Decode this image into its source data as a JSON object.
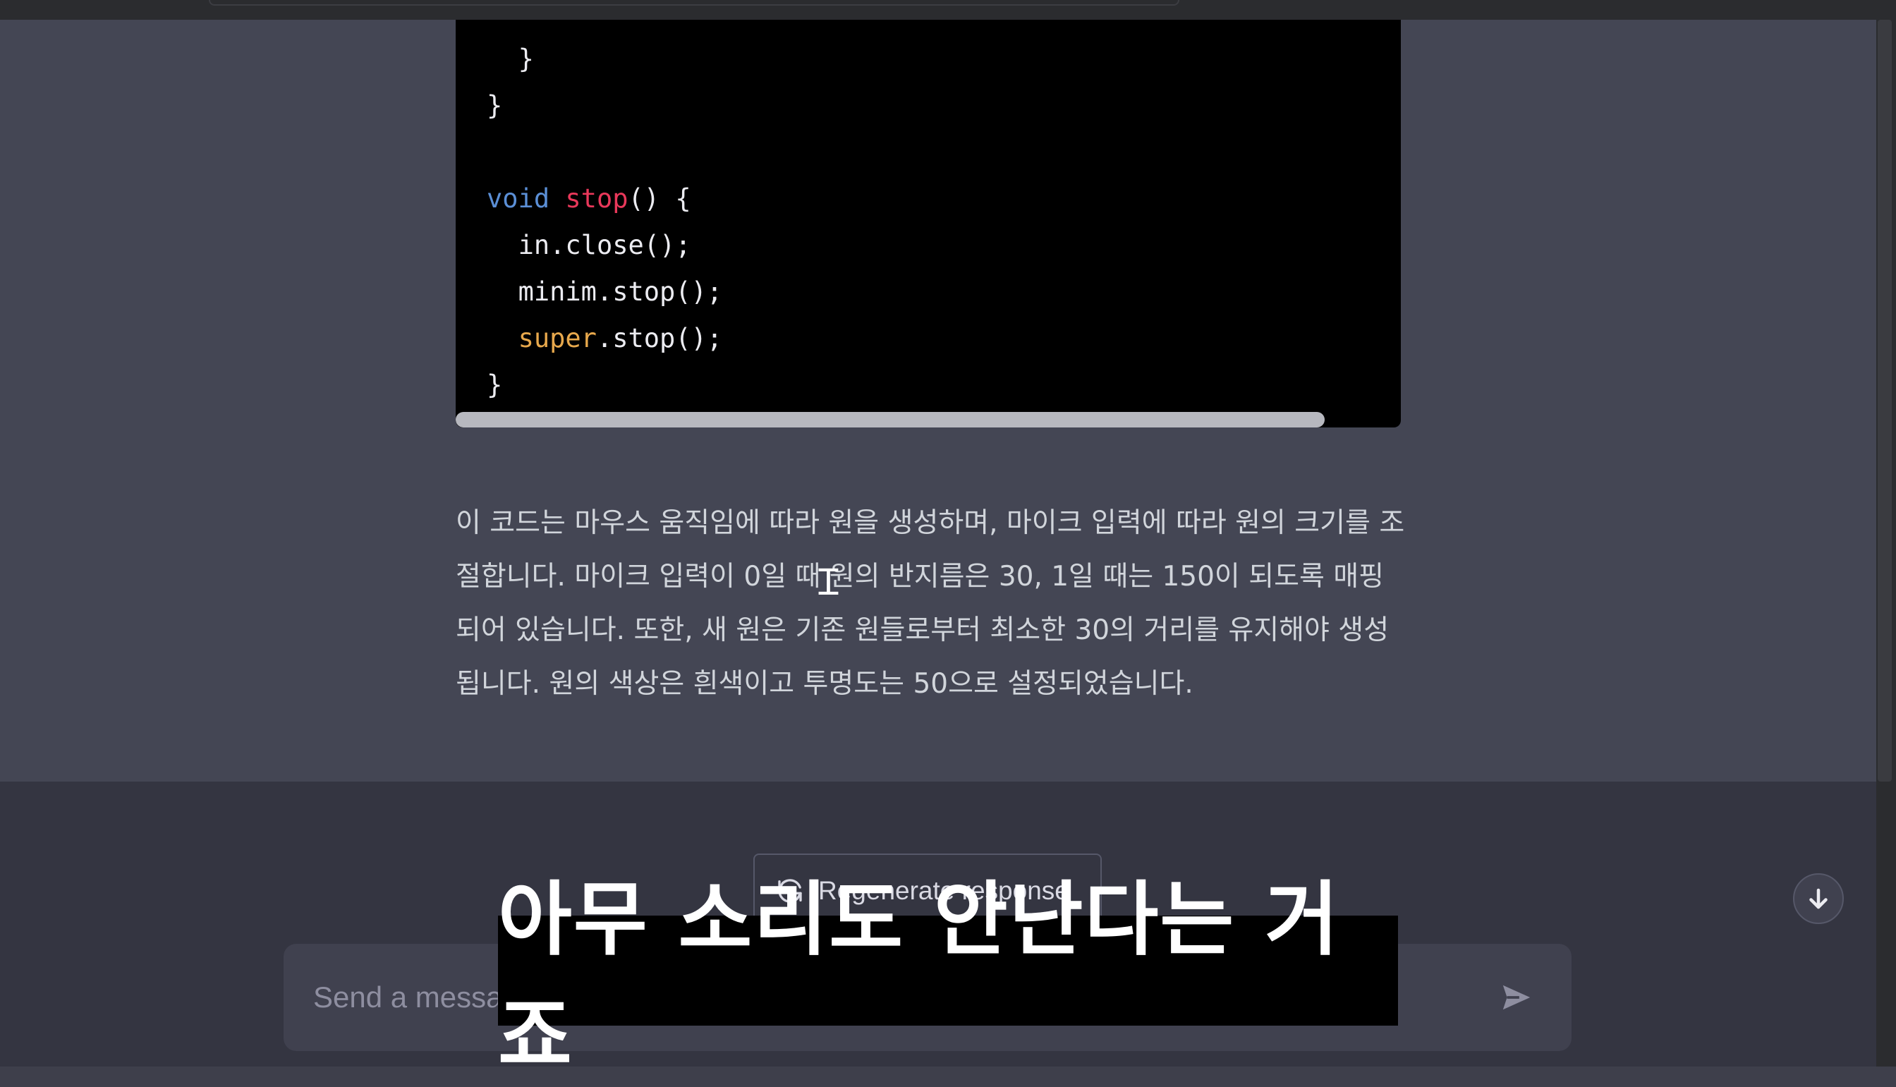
{
  "code": {
    "lines": [
      {
        "indent": "  ",
        "parts": [
          {
            "t": "}",
            "c": "plain"
          }
        ]
      },
      {
        "indent": "",
        "parts": [
          {
            "t": "}",
            "c": "plain"
          }
        ]
      },
      {
        "indent": "",
        "parts": []
      },
      {
        "indent": "",
        "parts": [
          {
            "t": "void",
            "c": "kw"
          },
          {
            "t": " ",
            "c": "plain"
          },
          {
            "t": "stop",
            "c": "fn"
          },
          {
            "t": "() {",
            "c": "plain"
          }
        ]
      },
      {
        "indent": "  ",
        "parts": [
          {
            "t": "in.close();",
            "c": "plain"
          }
        ]
      },
      {
        "indent": "  ",
        "parts": [
          {
            "t": "minim.stop();",
            "c": "plain"
          }
        ]
      },
      {
        "indent": "  ",
        "parts": [
          {
            "t": "super",
            "c": "sup"
          },
          {
            "t": ".stop();",
            "c": "plain"
          }
        ]
      },
      {
        "indent": "",
        "parts": [
          {
            "t": "}",
            "c": "plain"
          }
        ]
      }
    ]
  },
  "explanation": "이 코드는 마우스 움직임에 따라 원을 생성하며, 마이크 입력에 따라 원의 크기를 조절합니다. 마이크 입력이 0일 때 원의 반지름은 30, 1일 때는 150이 되도록 매핑되어 있습니다. 또한, 새 원은 기존 원들로부터 최소한 30의 거리를 유지해야 생성됩니다. 원의 색상은 흰색이고 투명도는 50으로 설정되었습니다.",
  "regenerate_label": "Regenerate response",
  "input": {
    "placeholder": "Send a message",
    "value": ""
  },
  "subtitle": "아무 소리도 안난다는 거죠",
  "icons": {
    "regenerate": "refresh-icon",
    "scroll_down": "arrow-down-icon",
    "send": "paper-plane-icon",
    "cursor": "text-cursor-icon"
  },
  "colors": {
    "chat_bg": "#444654",
    "input_area_bg": "#343541",
    "code_bg": "#000000",
    "keyword": "#5b8fd6",
    "function": "#e9385a",
    "super": "#e7a84c"
  }
}
